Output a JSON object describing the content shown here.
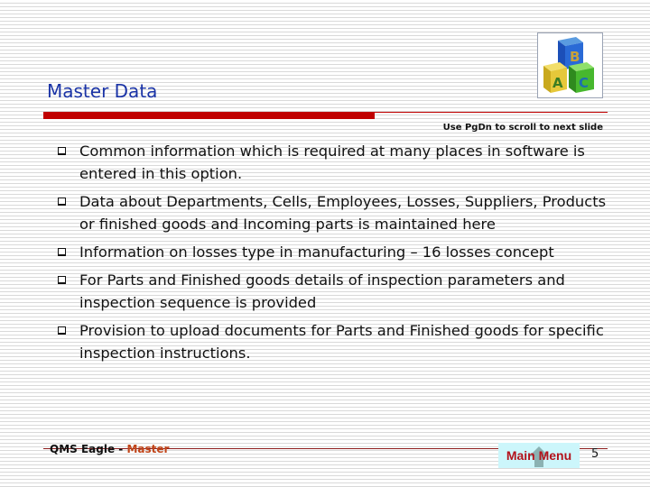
{
  "slide": {
    "title": "Master Data",
    "hint": "Use PgDn to scroll to next slide",
    "logo_icon": "abc-blocks-icon",
    "bullets": [
      {
        "text": "Common information which is required at many places in software is entered in this option."
      },
      {
        "text": "Data about Departments, Cells, Employees, Losses,  Suppliers, Products or finished goods and Incoming parts is maintained here"
      },
      {
        "text": "Information on losses type in manufacturing – 16 losses concept"
      },
      {
        "text": "For Parts and Finished goods details of inspection parameters and inspection sequence is provided"
      },
      {
        "text": "Provision to upload documents for Parts and Finished goods for specific inspection instructions."
      }
    ]
  },
  "footer": {
    "product": "QMS Eagle",
    "separator": " - ",
    "section": "Master",
    "main_menu_label": "Main Menu",
    "page_number": "5"
  },
  "colors": {
    "title": "#1a33a6",
    "accent_rule": "#c00000",
    "footer_section": "#c0451a",
    "main_menu_bg": "#ccf6fb",
    "main_menu_text": "#b3121b"
  }
}
